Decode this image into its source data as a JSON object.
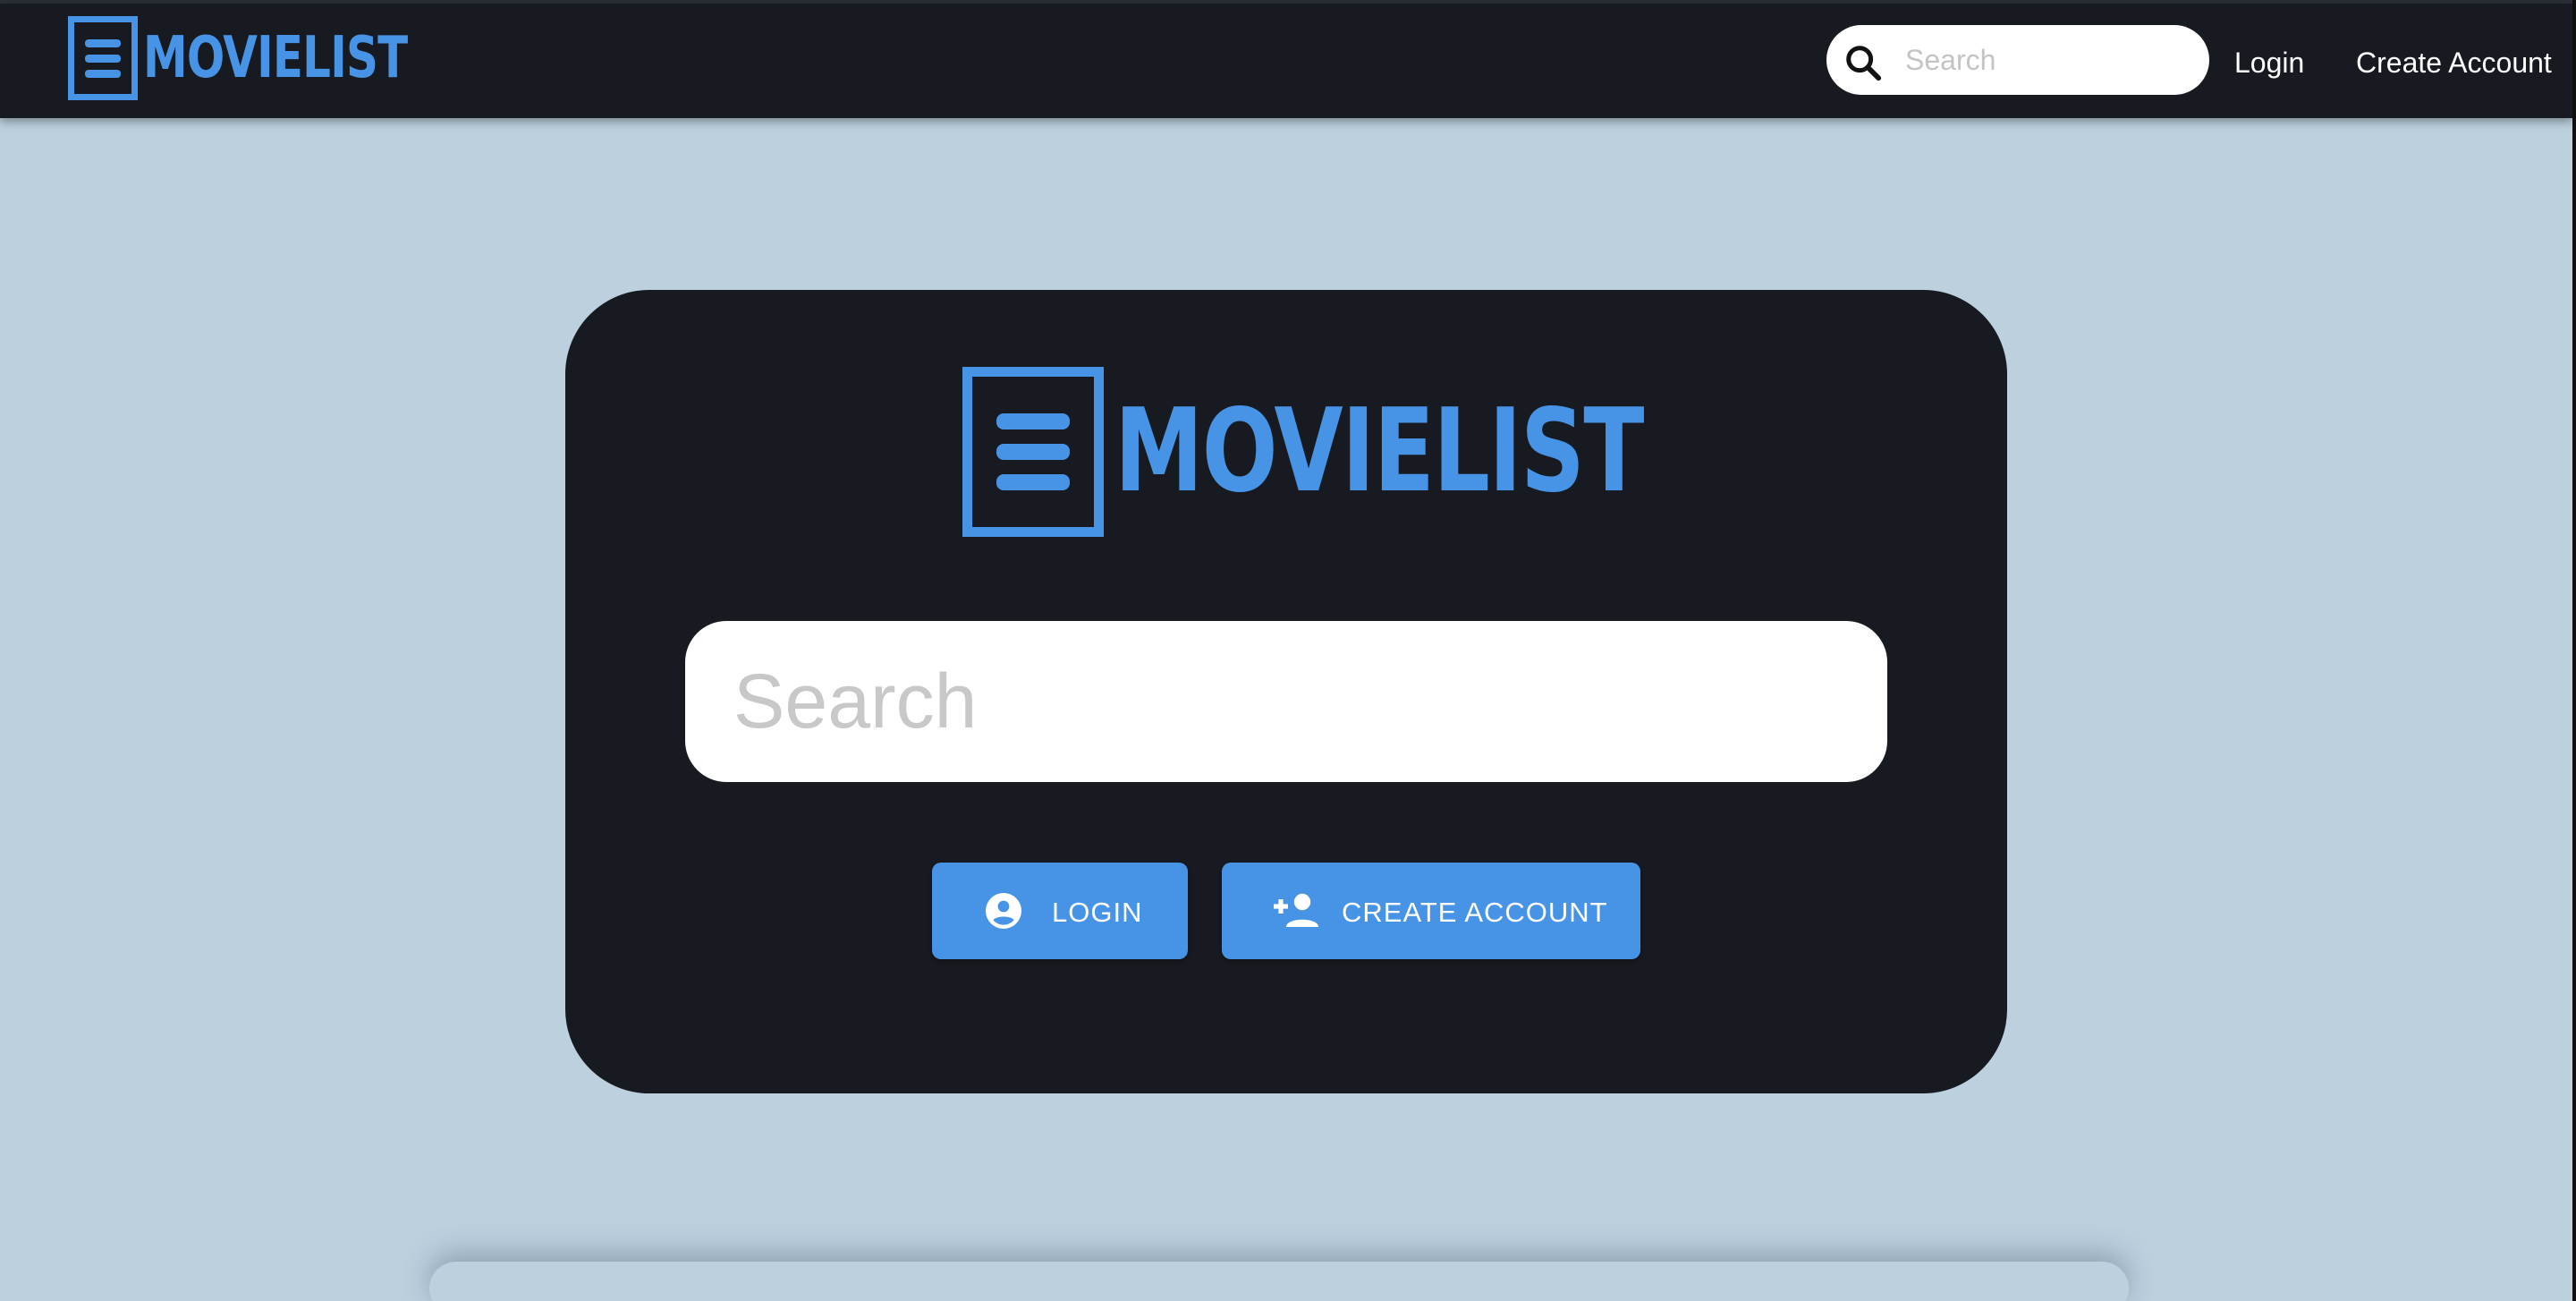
{
  "navbar": {
    "logo_text": "MOVIELIST",
    "search_placeholder": "Search",
    "login_label": "Login",
    "create_account_label": "Create Account"
  },
  "hero": {
    "logo_text": "MOVIELIST",
    "search_placeholder": "Search",
    "login_button_label": "LOGIN",
    "create_account_button_label": "CREATE ACCOUNT"
  },
  "icons": {
    "logo": "list-box-icon",
    "nav_search": "search-icon",
    "login": "account-circle-icon",
    "create_account": "person-add-icon"
  },
  "colors": {
    "accent": "#4794e6",
    "navbar_bg": "#171a20",
    "page_bg": "#bcd0de",
    "card_bg": "#171a20"
  }
}
